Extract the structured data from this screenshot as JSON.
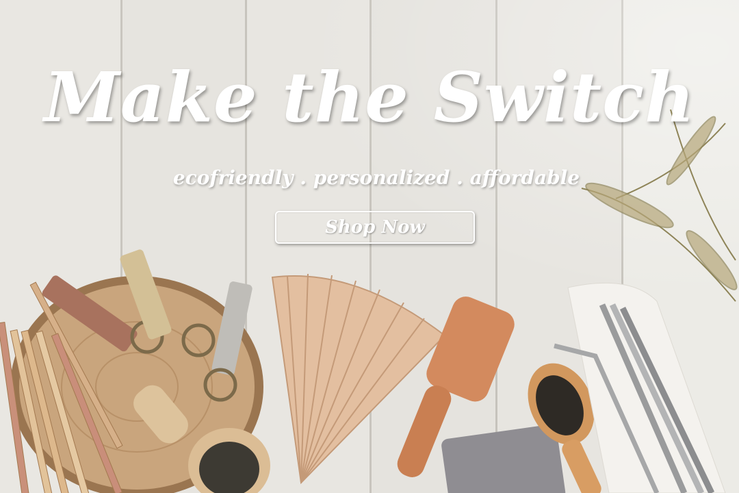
{
  "hero": {
    "title": "Make the Switch",
    "tagline": "ecofriendly . personalized . affordable",
    "cta_label": "Shop Now"
  },
  "colors": {
    "text": "#ffffff",
    "wood": "#c98a5e",
    "wall": "#e8e6e1"
  }
}
